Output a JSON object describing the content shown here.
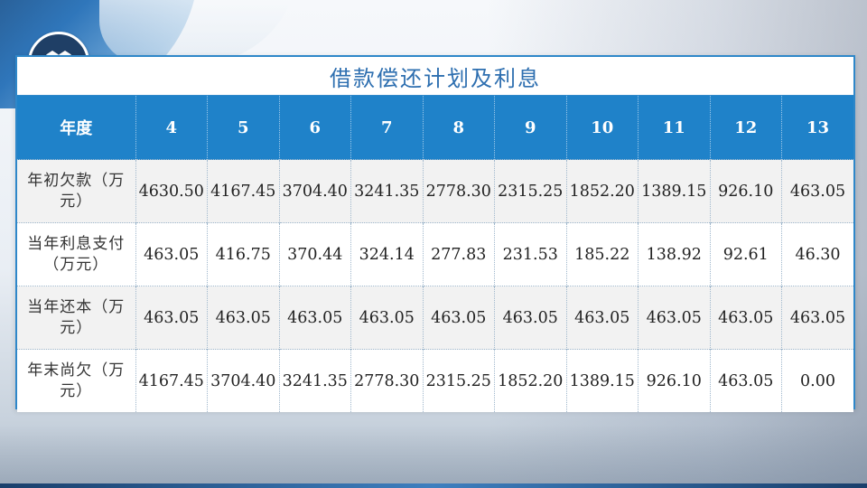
{
  "slide": {
    "title": "借款偿还计划及利息",
    "logo_icon": "dropbox-icon"
  },
  "table": {
    "header_label": "年度",
    "years": [
      "4",
      "5",
      "6",
      "7",
      "8",
      "9",
      "10",
      "11",
      "12",
      "13"
    ],
    "rows": [
      {
        "label": "年初欠款（万元）",
        "values": [
          "4630.50",
          "4167.45",
          "3704.40",
          "3241.35",
          "2778.30",
          "2315.25",
          "1852.20",
          "1389.15",
          "926.10",
          "463.05"
        ]
      },
      {
        "label": "当年利息支付（万元）",
        "values": [
          "463.05",
          "416.75",
          "370.44",
          "324.14",
          "277.83",
          "231.53",
          "185.22",
          "138.92",
          "92.61",
          "46.30"
        ]
      },
      {
        "label": "当年还本（万元）",
        "values": [
          "463.05",
          "463.05",
          "463.05",
          "463.05",
          "463.05",
          "463.05",
          "463.05",
          "463.05",
          "463.05",
          "463.05"
        ]
      },
      {
        "label": "年末尚欠（万元）",
        "values": [
          "4167.45",
          "3704.40",
          "3241.35",
          "2778.30",
          "2315.25",
          "1852.20",
          "1389.15",
          "926.10",
          "463.05",
          "0.00"
        ]
      }
    ]
  },
  "colors": {
    "header_bg": "#1f82c9",
    "title_text": "#2e6fb0",
    "border": "#2e87c9",
    "stripe": "#f2f2f2"
  }
}
